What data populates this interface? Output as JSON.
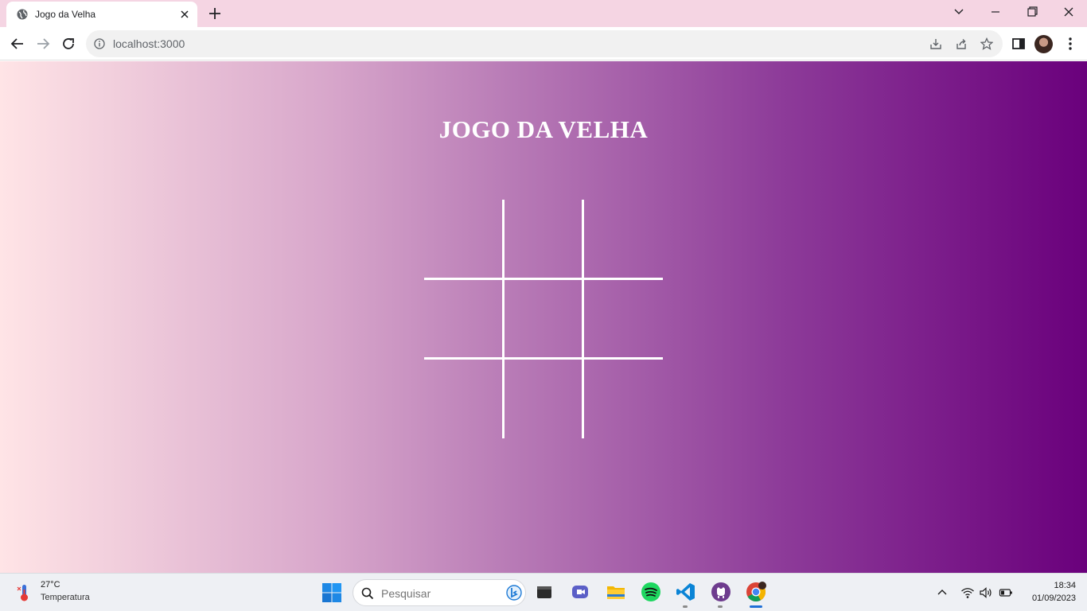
{
  "browser": {
    "tab_title": "Jogo da Velha",
    "url": "localhost:3000"
  },
  "page": {
    "title": "JOGO DA VELHA",
    "board": {
      "rows": 3,
      "cols": 3,
      "cells": [
        "",
        "",
        "",
        "",
        "",
        "",
        "",
        "",
        ""
      ]
    }
  },
  "taskbar": {
    "weather_temp": "27°C",
    "weather_label": "Temperatura",
    "search_placeholder": "Pesquisar",
    "apps": [
      "explorer-icon",
      "teams-icon",
      "folder-icon",
      "spotify-icon",
      "vscode-icon",
      "github-desktop-icon",
      "chrome-icon"
    ],
    "time": "18:34",
    "date": "01/09/2023"
  },
  "colors": {
    "tabbar": "#f5d5e3",
    "gradient_start": "#ffe4e6",
    "gradient_end": "#6a007c",
    "board_lines": "#ffffff",
    "title": "#ffffff"
  }
}
